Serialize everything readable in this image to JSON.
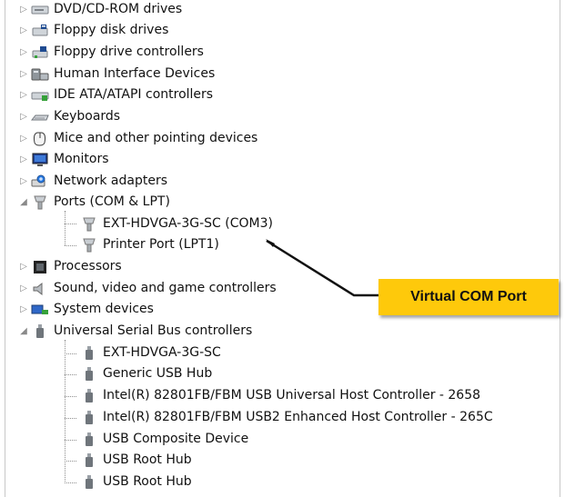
{
  "tree": {
    "top_items": [
      {
        "label": "DVD/CD-ROM drives",
        "icon": "dvd-icon",
        "expanded": false
      },
      {
        "label": "Floppy disk drives",
        "icon": "floppy-disk-icon",
        "expanded": false
      },
      {
        "label": "Floppy drive controllers",
        "icon": "floppy-controller-icon",
        "expanded": false
      },
      {
        "label": "Human Interface Devices",
        "icon": "human-interface-icon",
        "expanded": false
      },
      {
        "label": "IDE ATA/ATAPI controllers",
        "icon": "ide-controller-icon",
        "expanded": false
      },
      {
        "label": "Keyboards",
        "icon": "keyboard-icon",
        "expanded": false
      },
      {
        "label": "Mice and other pointing devices",
        "icon": "mouse-icon",
        "expanded": false
      },
      {
        "label": "Monitors",
        "icon": "monitor-icon",
        "expanded": false
      },
      {
        "label": "Network adapters",
        "icon": "network-adapter-icon",
        "expanded": false
      },
      {
        "label": "Ports (COM & LPT)",
        "icon": "port-icon",
        "expanded": true
      },
      {
        "label": "Processors",
        "icon": "processor-icon",
        "expanded": false
      },
      {
        "label": "Sound, video and game controllers",
        "icon": "sound-icon",
        "expanded": false
      },
      {
        "label": "System devices",
        "icon": "system-devices-icon",
        "expanded": false
      },
      {
        "label": "Universal Serial Bus controllers",
        "icon": "usb-icon",
        "expanded": true
      }
    ],
    "ports_children": [
      {
        "label": "EXT-HDVGA-3G-SC (COM3)",
        "icon": "port-icon"
      },
      {
        "label": "Printer Port (LPT1)",
        "icon": "port-icon"
      }
    ],
    "usb_children": [
      {
        "label": "EXT-HDVGA-3G-SC",
        "icon": "usb-icon"
      },
      {
        "label": "Generic USB Hub",
        "icon": "usb-icon"
      },
      {
        "label": "Intel(R) 82801FB/FBM USB Universal Host Controller - 2658",
        "icon": "usb-icon"
      },
      {
        "label": "Intel(R) 82801FB/FBM USB2 Enhanced Host Controller - 265C",
        "icon": "usb-icon"
      },
      {
        "label": "USB Composite Device",
        "icon": "usb-icon"
      },
      {
        "label": "USB Root Hub",
        "icon": "usb-icon"
      },
      {
        "label": "USB Root Hub",
        "icon": "usb-icon"
      }
    ]
  },
  "callout": {
    "label": "Virtual COM Port",
    "color": "#fec90b"
  },
  "colors": {
    "tree_text": "#111111",
    "frame": "#c8c8c8"
  }
}
